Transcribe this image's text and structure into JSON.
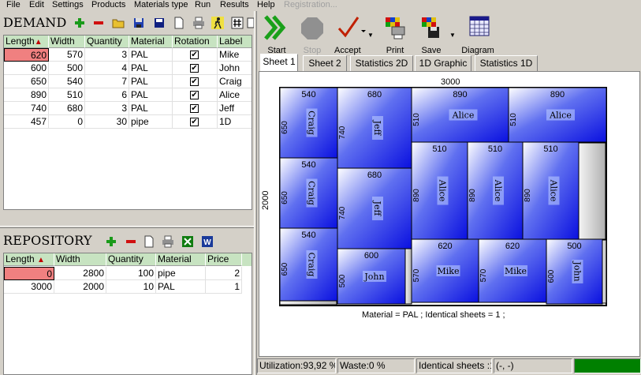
{
  "menu": {
    "items": [
      "File",
      "Edit",
      "Settings",
      "Products",
      "Materials type",
      "Run",
      "Results",
      "Help"
    ],
    "registration": "Registration..."
  },
  "demand": {
    "title": "DEMAND",
    "columns": [
      "Length",
      "Width",
      "Quantity",
      "Material",
      "Rotation",
      "Label"
    ],
    "sort_indicator": "▲",
    "rows": [
      {
        "length": "620",
        "width": "570",
        "quantity": "3",
        "material": "PAL",
        "rotation": true,
        "label": "Mike"
      },
      {
        "length": "600",
        "width": "500",
        "quantity": "4",
        "material": "PAL",
        "rotation": true,
        "label": "John"
      },
      {
        "length": "650",
        "width": "540",
        "quantity": "7",
        "material": "PAL",
        "rotation": true,
        "label": "Craig"
      },
      {
        "length": "890",
        "width": "510",
        "quantity": "6",
        "material": "PAL",
        "rotation": true,
        "label": "Alice"
      },
      {
        "length": "740",
        "width": "680",
        "quantity": "3",
        "material": "PAL",
        "rotation": true,
        "label": "Jeff"
      },
      {
        "length": "457",
        "width": "0",
        "quantity": "30",
        "material": "pipe",
        "rotation": true,
        "label": "1D"
      }
    ]
  },
  "repository": {
    "title": "REPOSITORY",
    "columns": [
      "Length",
      "Width",
      "Quantity",
      "Material",
      "Price"
    ],
    "sort_indicator": "▲",
    "rows": [
      {
        "length": "0",
        "width": "2800",
        "quantity": "100",
        "material": "pipe",
        "price": "2"
      },
      {
        "length": "3000",
        "width": "2000",
        "quantity": "10",
        "material": "PAL",
        "price": "1"
      }
    ]
  },
  "toolbar": {
    "start": "Start",
    "stop": "Stop",
    "accept": "Accept",
    "print": "Print",
    "save": "Save",
    "diagram": "Diagram"
  },
  "tabs": [
    "Sheet 1",
    "Sheet 2",
    "Statistics 2D",
    "1D Graphic",
    "Statistics 1D"
  ],
  "sheet": {
    "width_label": "3000",
    "height_label": "2000",
    "caption": "Material = PAL ; Identical sheets  = 1 ;",
    "colors": {
      "piece_dark": "#0a10e0",
      "piece_light": "#ffffff",
      "waste": "#c8c8c8",
      "border": "#000000"
    },
    "pieces": [
      {
        "name": "Craig",
        "top": "540",
        "side": "650"
      },
      {
        "name": "Jeff",
        "top": "680",
        "side": "740"
      },
      {
        "name": "Alice",
        "top": "890",
        "side": "510"
      },
      {
        "name": "Alice",
        "top": "890",
        "side": "510"
      },
      {
        "name": "Craig",
        "top": "540",
        "side": "650"
      },
      {
        "name": "Jeff",
        "top": "680",
        "side": "740"
      },
      {
        "name": "Alice",
        "top": "510",
        "side": "890"
      },
      {
        "name": "Alice",
        "top": "510",
        "side": "890"
      },
      {
        "name": "Alice",
        "top": "510",
        "side": "890"
      },
      {
        "name": "Craig",
        "top": "540",
        "side": "650"
      },
      {
        "name": "John",
        "top": "600",
        "side": "500"
      },
      {
        "name": "Mike",
        "top": "620",
        "side": "570"
      },
      {
        "name": "Mike",
        "top": "620",
        "side": "570"
      },
      {
        "name": "John",
        "top": "500",
        "side": "600"
      }
    ]
  },
  "status": {
    "utilization": "Utilization:93,92 %",
    "waste": "Waste:0 %",
    "identical": "Identical sheets :1",
    "coords": "(-, -)",
    "progress": 1.0,
    "progress_color": "#008000"
  }
}
